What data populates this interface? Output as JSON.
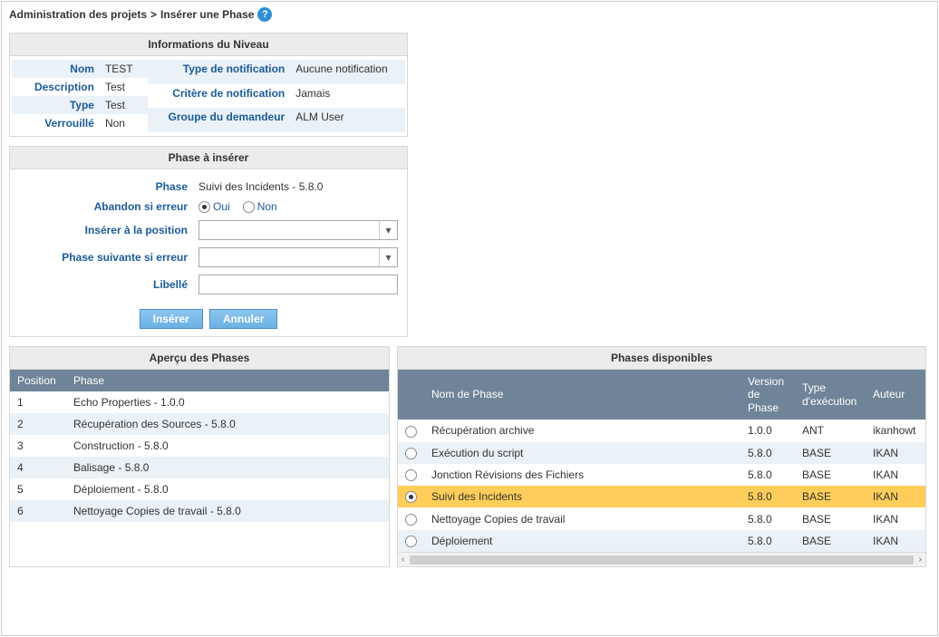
{
  "breadcrumb": {
    "root": "Administration des projets",
    "sep": ">",
    "page": "Insérer une Phase"
  },
  "level_info": {
    "title": "Informations du Niveau",
    "left": {
      "nom_label": "Nom",
      "nom_val": "TEST",
      "desc_label": "Description",
      "desc_val": "Test",
      "type_label": "Type",
      "type_val": "Test",
      "lock_label": "Verrouillé",
      "lock_val": "Non"
    },
    "right": {
      "notif_label": "Type de notification",
      "notif_val": "Aucune notification",
      "crit_label": "Critère de notification",
      "crit_val": "Jamais",
      "group_label": "Groupe du demandeur",
      "group_val": "ALM User"
    }
  },
  "insert_form": {
    "title": "Phase à insérer",
    "phase_label": "Phase",
    "phase_val": "Suivi des Incidents - 5.8.0",
    "abort_label": "Abandon si erreur",
    "abort_yes": "Oui",
    "abort_no": "Non",
    "pos_label": "Insérer à la position",
    "next_label": "Phase suivante si erreur",
    "libelle_label": "Libellé",
    "btn_insert": "Insérer",
    "btn_cancel": "Annuler"
  },
  "overview": {
    "title": "Aperçu des Phases",
    "col_pos": "Position",
    "col_phase": "Phase",
    "rows": [
      {
        "pos": "1",
        "name": "Echo Properties - 1.0.0"
      },
      {
        "pos": "2",
        "name": "Récupération des Sources - 5.8.0"
      },
      {
        "pos": "3",
        "name": "Construction - 5.8.0"
      },
      {
        "pos": "4",
        "name": "Balisage - 5.8.0"
      },
      {
        "pos": "5",
        "name": "Déploiement - 5.8.0"
      },
      {
        "pos": "6",
        "name": "Nettoyage Copies de travail - 5.8.0"
      }
    ]
  },
  "available": {
    "title": "Phases disponibles",
    "col_name": "Nom de Phase",
    "col_ver": "Version de Phase",
    "col_exec": "Type d'exécution",
    "col_auth": "Auteur",
    "rows": [
      {
        "name": "Récupération archive",
        "ver": "1.0.0",
        "exec": "ANT",
        "auth": "ikanhowt",
        "sel": false
      },
      {
        "name": "Exécution du script",
        "ver": "5.8.0",
        "exec": "BASE",
        "auth": "IKAN",
        "sel": false
      },
      {
        "name": "Jonction Révisions des Fichiers",
        "ver": "5.8.0",
        "exec": "BASE",
        "auth": "IKAN",
        "sel": false
      },
      {
        "name": "Suivi des Incidents",
        "ver": "5.8.0",
        "exec": "BASE",
        "auth": "IKAN",
        "sel": true
      },
      {
        "name": "Nettoyage Copies de travail",
        "ver": "5.8.0",
        "exec": "BASE",
        "auth": "IKAN",
        "sel": false
      },
      {
        "name": "Déploiement",
        "ver": "5.8.0",
        "exec": "BASE",
        "auth": "IKAN",
        "sel": false
      }
    ]
  }
}
